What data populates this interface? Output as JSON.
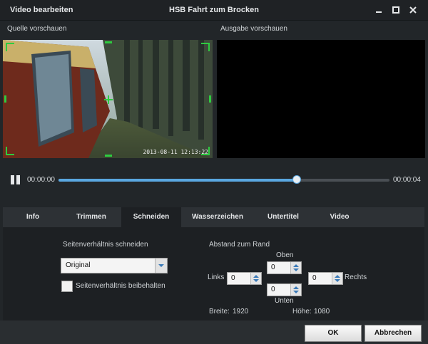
{
  "window": {
    "app_title": "Video bearbeiten",
    "document_title": "HSB Fahrt zum Brocken"
  },
  "previews": {
    "source_label": "Quelle vorschauen",
    "output_label": "Ausgabe vorschauen",
    "source_timestamp": "2013-08-11 12:13:22"
  },
  "player": {
    "current_time": "00:00:00",
    "total_time": "00:00:04",
    "progress": 0.72
  },
  "tabs": [
    {
      "label": "Info",
      "active": false
    },
    {
      "label": "Trimmen",
      "active": false
    },
    {
      "label": "Schneiden",
      "active": true
    },
    {
      "label": "Wasserzeichen",
      "active": false
    },
    {
      "label": "Untertitel",
      "active": false
    },
    {
      "label": "Video",
      "active": false
    }
  ],
  "crop": {
    "aspect_label": "Seitenverhältnis schneiden",
    "aspect_value": "Original",
    "keep_aspect_label": "Seitenverhältnis beibehalten",
    "keep_aspect_checked": false,
    "margin_label": "Abstand zum Rand",
    "top_label": "Oben",
    "top_value": "0",
    "left_label": "Links",
    "left_value": "0",
    "right_label": "Rechts",
    "right_value": "0",
    "bottom_label": "Unten",
    "bottom_value": "0",
    "width_label": "Breite:",
    "width_value": "1920",
    "height_label": "Höhe:",
    "height_value": "1080"
  },
  "buttons": {
    "ok": "OK",
    "cancel": "Abbrechen"
  },
  "colors": {
    "accent": "#5aa7e0",
    "crop_handles": "#2ecc40"
  }
}
